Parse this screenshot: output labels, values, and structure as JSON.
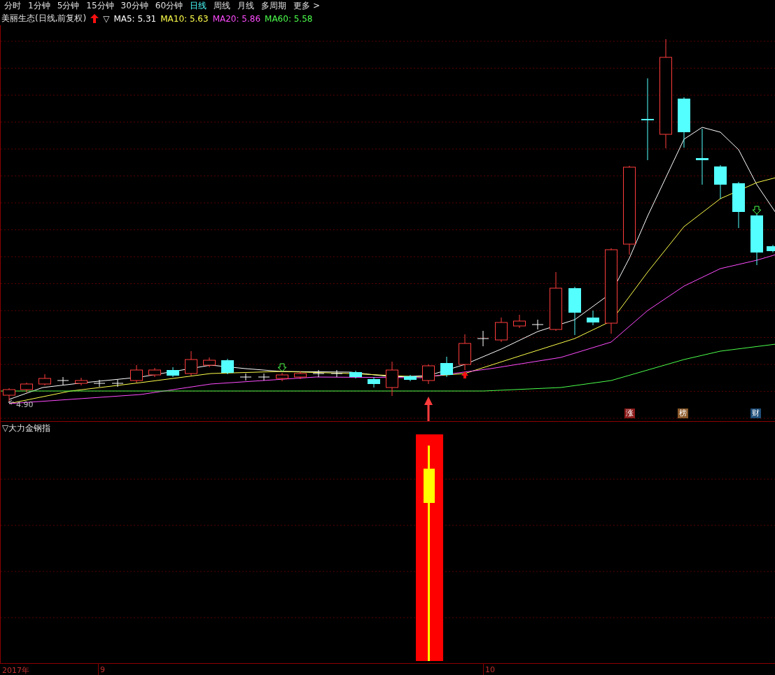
{
  "periods": [
    {
      "label": "分时",
      "selected": false
    },
    {
      "label": "1分钟",
      "selected": false
    },
    {
      "label": "5分钟",
      "selected": false
    },
    {
      "label": "15分钟",
      "selected": false
    },
    {
      "label": "30分钟",
      "selected": false
    },
    {
      "label": "60分钟",
      "selected": false
    },
    {
      "label": "日线",
      "selected": true
    },
    {
      "label": "周线",
      "selected": false
    },
    {
      "label": "月线",
      "selected": false
    },
    {
      "label": "多周期",
      "selected": false
    },
    {
      "label": "更多 >",
      "selected": false
    }
  ],
  "legend": {
    "title": "美丽生态(日线,前复权)",
    "marker": "▽",
    "ma": [
      {
        "label": "MA5: 5.31",
        "color": "#ffffff"
      },
      {
        "label": "MA10: 5.63",
        "color": "#ffff4c"
      },
      {
        "label": "MA20: 5.86",
        "color": "#ff4cff"
      },
      {
        "label": "MA60: 5.58",
        "color": "#4cff4c"
      }
    ]
  },
  "low_marker": "4.90",
  "badges": [
    {
      "label": "涨",
      "color": "#8b1a1a"
    },
    {
      "label": "榜",
      "color": "#8b5a2b"
    },
    {
      "label": "财",
      "color": "#1f4e79"
    }
  ],
  "indicator": {
    "marker": "▽",
    "title": "大力金钢指"
  },
  "time_axis": [
    "2017年",
    "9",
    "10"
  ]
}
